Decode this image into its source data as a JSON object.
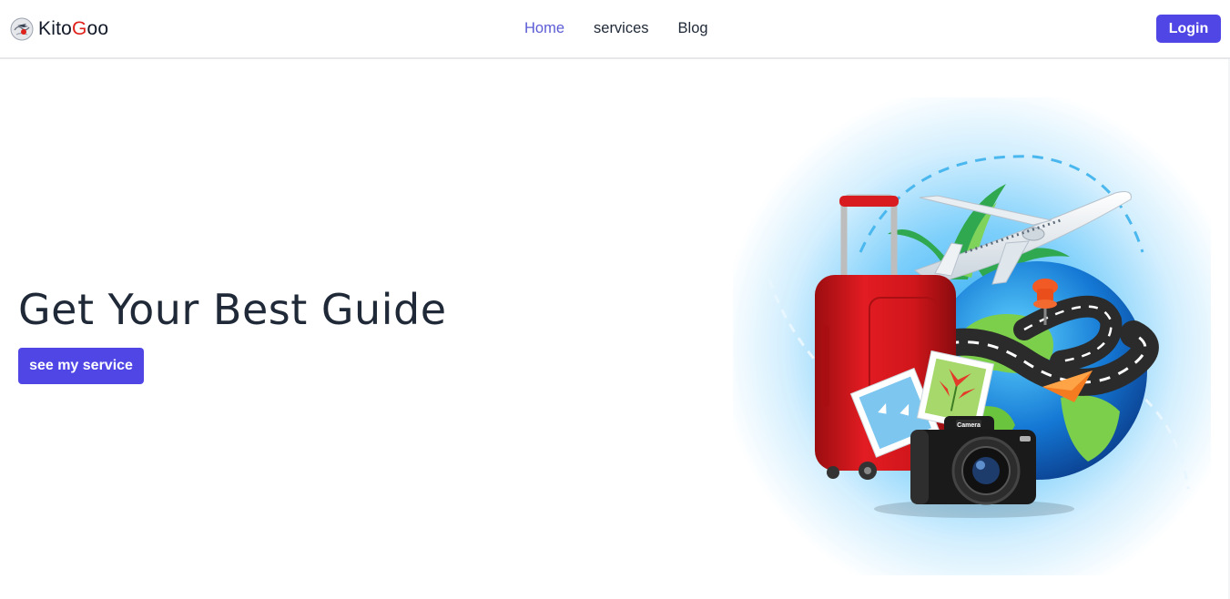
{
  "brand": {
    "name_prefix": "Kito",
    "name_highlight": "G",
    "name_suffix": "oo",
    "logo_icon": "travel-globe-icon",
    "highlight_color": "#e0201b"
  },
  "nav": {
    "items": [
      {
        "label": "Home",
        "active": true
      },
      {
        "label": "services",
        "active": false
      },
      {
        "label": "Blog",
        "active": false
      }
    ],
    "active_color": "#5b5bd6"
  },
  "header": {
    "login_label": "Login"
  },
  "hero": {
    "title": "Get Your Best Guide",
    "cta_label": "see my service",
    "illustration_icon": "travel-illustration",
    "camera_label": "Camera"
  },
  "colors": {
    "primary": "#4f46e5",
    "text": "#1f2937"
  }
}
